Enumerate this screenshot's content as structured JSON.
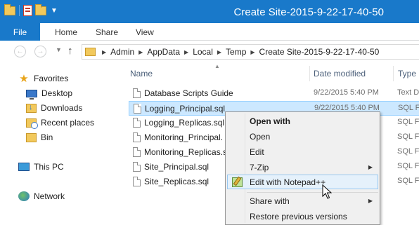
{
  "window": {
    "title": "Create Site-2015-9-22-17-40-50"
  },
  "ribbon": {
    "file_label": "File",
    "tabs": [
      {
        "label": "Home"
      },
      {
        "label": "Share"
      },
      {
        "label": "View"
      }
    ]
  },
  "address": {
    "crumbs": [
      "Admin",
      "AppData",
      "Local",
      "Temp",
      "Create Site-2015-9-22-17-40-50"
    ]
  },
  "navpane": {
    "favorites_label": "Favorites",
    "favorites": [
      {
        "label": "Desktop",
        "icon": "desktop-icon"
      },
      {
        "label": "Downloads",
        "icon": "downloads-folder-icon"
      },
      {
        "label": "Recent places",
        "icon": "recent-places-icon"
      },
      {
        "label": "Bin",
        "icon": "folder-icon"
      }
    ],
    "this_pc_label": "This PC",
    "network_label": "Network"
  },
  "columns": {
    "name": "Name",
    "date": "Date modified",
    "type": "Type"
  },
  "files": [
    {
      "name": "Database Scripts Guide",
      "date": "9/22/2015 5:40 PM",
      "type": "Text D",
      "selected": false
    },
    {
      "name": "Logging_Principal.sql",
      "date": "9/22/2015 5:40 PM",
      "type": "SQL F",
      "selected": true
    },
    {
      "name": "Logging_Replicas.sql",
      "date": "",
      "type": "SQL F",
      "selected": false
    },
    {
      "name": "Monitoring_Principal.",
      "date": "",
      "type": "SQL F",
      "selected": false
    },
    {
      "name": "Monitoring_Replicas.s",
      "date": "",
      "type": "SQL F",
      "selected": false
    },
    {
      "name": "Site_Principal.sql",
      "date": "",
      "type": "SQL F",
      "selected": false
    },
    {
      "name": "Site_Replicas.sql",
      "date": "",
      "type": "SQL F",
      "selected": false
    }
  ],
  "context_menu": {
    "open_with_bold": "Open with",
    "open": "Open",
    "edit": "Edit",
    "seven_zip": "7-Zip",
    "edit_with_notepad": "Edit with Notepad++",
    "share_with": "Share with",
    "restore_previous": "Restore previous versions"
  },
  "colors": {
    "title_bar": "#1979ca",
    "selection": "#cce8ff",
    "menu_hover": "#e5f1fb"
  }
}
